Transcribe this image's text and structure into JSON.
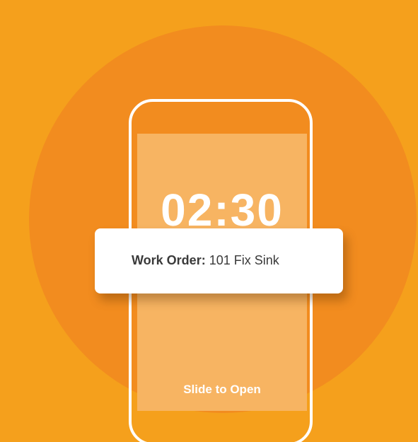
{
  "lock_screen": {
    "time": "02:30",
    "slide_label": "Slide to Open"
  },
  "notification": {
    "label": "Work Order:",
    "value": " 101 Fix Sink"
  },
  "colors": {
    "background": "#F5A01C",
    "circle": "#F28C1F",
    "screen": "#F7B462",
    "white": "#FFFFFF"
  }
}
